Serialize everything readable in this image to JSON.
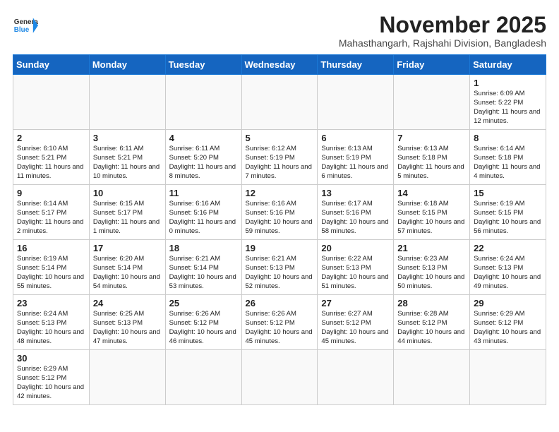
{
  "logo": {
    "text_general": "General",
    "text_blue": "Blue"
  },
  "title": "November 2025",
  "subtitle": "Mahasthangarh, Rajshahi Division, Bangladesh",
  "weekdays": [
    "Sunday",
    "Monday",
    "Tuesday",
    "Wednesday",
    "Thursday",
    "Friday",
    "Saturday"
  ],
  "weeks": [
    [
      {
        "day": "",
        "info": ""
      },
      {
        "day": "",
        "info": ""
      },
      {
        "day": "",
        "info": ""
      },
      {
        "day": "",
        "info": ""
      },
      {
        "day": "",
        "info": ""
      },
      {
        "day": "",
        "info": ""
      },
      {
        "day": "1",
        "info": "Sunrise: 6:09 AM\nSunset: 5:22 PM\nDaylight: 11 hours and 12 minutes."
      }
    ],
    [
      {
        "day": "2",
        "info": "Sunrise: 6:10 AM\nSunset: 5:21 PM\nDaylight: 11 hours and 11 minutes."
      },
      {
        "day": "3",
        "info": "Sunrise: 6:11 AM\nSunset: 5:21 PM\nDaylight: 11 hours and 10 minutes."
      },
      {
        "day": "4",
        "info": "Sunrise: 6:11 AM\nSunset: 5:20 PM\nDaylight: 11 hours and 8 minutes."
      },
      {
        "day": "5",
        "info": "Sunrise: 6:12 AM\nSunset: 5:19 PM\nDaylight: 11 hours and 7 minutes."
      },
      {
        "day": "6",
        "info": "Sunrise: 6:13 AM\nSunset: 5:19 PM\nDaylight: 11 hours and 6 minutes."
      },
      {
        "day": "7",
        "info": "Sunrise: 6:13 AM\nSunset: 5:18 PM\nDaylight: 11 hours and 5 minutes."
      },
      {
        "day": "8",
        "info": "Sunrise: 6:14 AM\nSunset: 5:18 PM\nDaylight: 11 hours and 4 minutes."
      }
    ],
    [
      {
        "day": "9",
        "info": "Sunrise: 6:14 AM\nSunset: 5:17 PM\nDaylight: 11 hours and 2 minutes."
      },
      {
        "day": "10",
        "info": "Sunrise: 6:15 AM\nSunset: 5:17 PM\nDaylight: 11 hours and 1 minute."
      },
      {
        "day": "11",
        "info": "Sunrise: 6:16 AM\nSunset: 5:16 PM\nDaylight: 11 hours and 0 minutes."
      },
      {
        "day": "12",
        "info": "Sunrise: 6:16 AM\nSunset: 5:16 PM\nDaylight: 10 hours and 59 minutes."
      },
      {
        "day": "13",
        "info": "Sunrise: 6:17 AM\nSunset: 5:16 PM\nDaylight: 10 hours and 58 minutes."
      },
      {
        "day": "14",
        "info": "Sunrise: 6:18 AM\nSunset: 5:15 PM\nDaylight: 10 hours and 57 minutes."
      },
      {
        "day": "15",
        "info": "Sunrise: 6:19 AM\nSunset: 5:15 PM\nDaylight: 10 hours and 56 minutes."
      }
    ],
    [
      {
        "day": "16",
        "info": "Sunrise: 6:19 AM\nSunset: 5:14 PM\nDaylight: 10 hours and 55 minutes."
      },
      {
        "day": "17",
        "info": "Sunrise: 6:20 AM\nSunset: 5:14 PM\nDaylight: 10 hours and 54 minutes."
      },
      {
        "day": "18",
        "info": "Sunrise: 6:21 AM\nSunset: 5:14 PM\nDaylight: 10 hours and 53 minutes."
      },
      {
        "day": "19",
        "info": "Sunrise: 6:21 AM\nSunset: 5:13 PM\nDaylight: 10 hours and 52 minutes."
      },
      {
        "day": "20",
        "info": "Sunrise: 6:22 AM\nSunset: 5:13 PM\nDaylight: 10 hours and 51 minutes."
      },
      {
        "day": "21",
        "info": "Sunrise: 6:23 AM\nSunset: 5:13 PM\nDaylight: 10 hours and 50 minutes."
      },
      {
        "day": "22",
        "info": "Sunrise: 6:24 AM\nSunset: 5:13 PM\nDaylight: 10 hours and 49 minutes."
      }
    ],
    [
      {
        "day": "23",
        "info": "Sunrise: 6:24 AM\nSunset: 5:13 PM\nDaylight: 10 hours and 48 minutes."
      },
      {
        "day": "24",
        "info": "Sunrise: 6:25 AM\nSunset: 5:13 PM\nDaylight: 10 hours and 47 minutes."
      },
      {
        "day": "25",
        "info": "Sunrise: 6:26 AM\nSunset: 5:12 PM\nDaylight: 10 hours and 46 minutes."
      },
      {
        "day": "26",
        "info": "Sunrise: 6:26 AM\nSunset: 5:12 PM\nDaylight: 10 hours and 45 minutes."
      },
      {
        "day": "27",
        "info": "Sunrise: 6:27 AM\nSunset: 5:12 PM\nDaylight: 10 hours and 45 minutes."
      },
      {
        "day": "28",
        "info": "Sunrise: 6:28 AM\nSunset: 5:12 PM\nDaylight: 10 hours and 44 minutes."
      },
      {
        "day": "29",
        "info": "Sunrise: 6:29 AM\nSunset: 5:12 PM\nDaylight: 10 hours and 43 minutes."
      }
    ],
    [
      {
        "day": "30",
        "info": "Sunrise: 6:29 AM\nSunset: 5:12 PM\nDaylight: 10 hours and 42 minutes."
      },
      {
        "day": "",
        "info": ""
      },
      {
        "day": "",
        "info": ""
      },
      {
        "day": "",
        "info": ""
      },
      {
        "day": "",
        "info": ""
      },
      {
        "day": "",
        "info": ""
      },
      {
        "day": "",
        "info": ""
      }
    ]
  ]
}
